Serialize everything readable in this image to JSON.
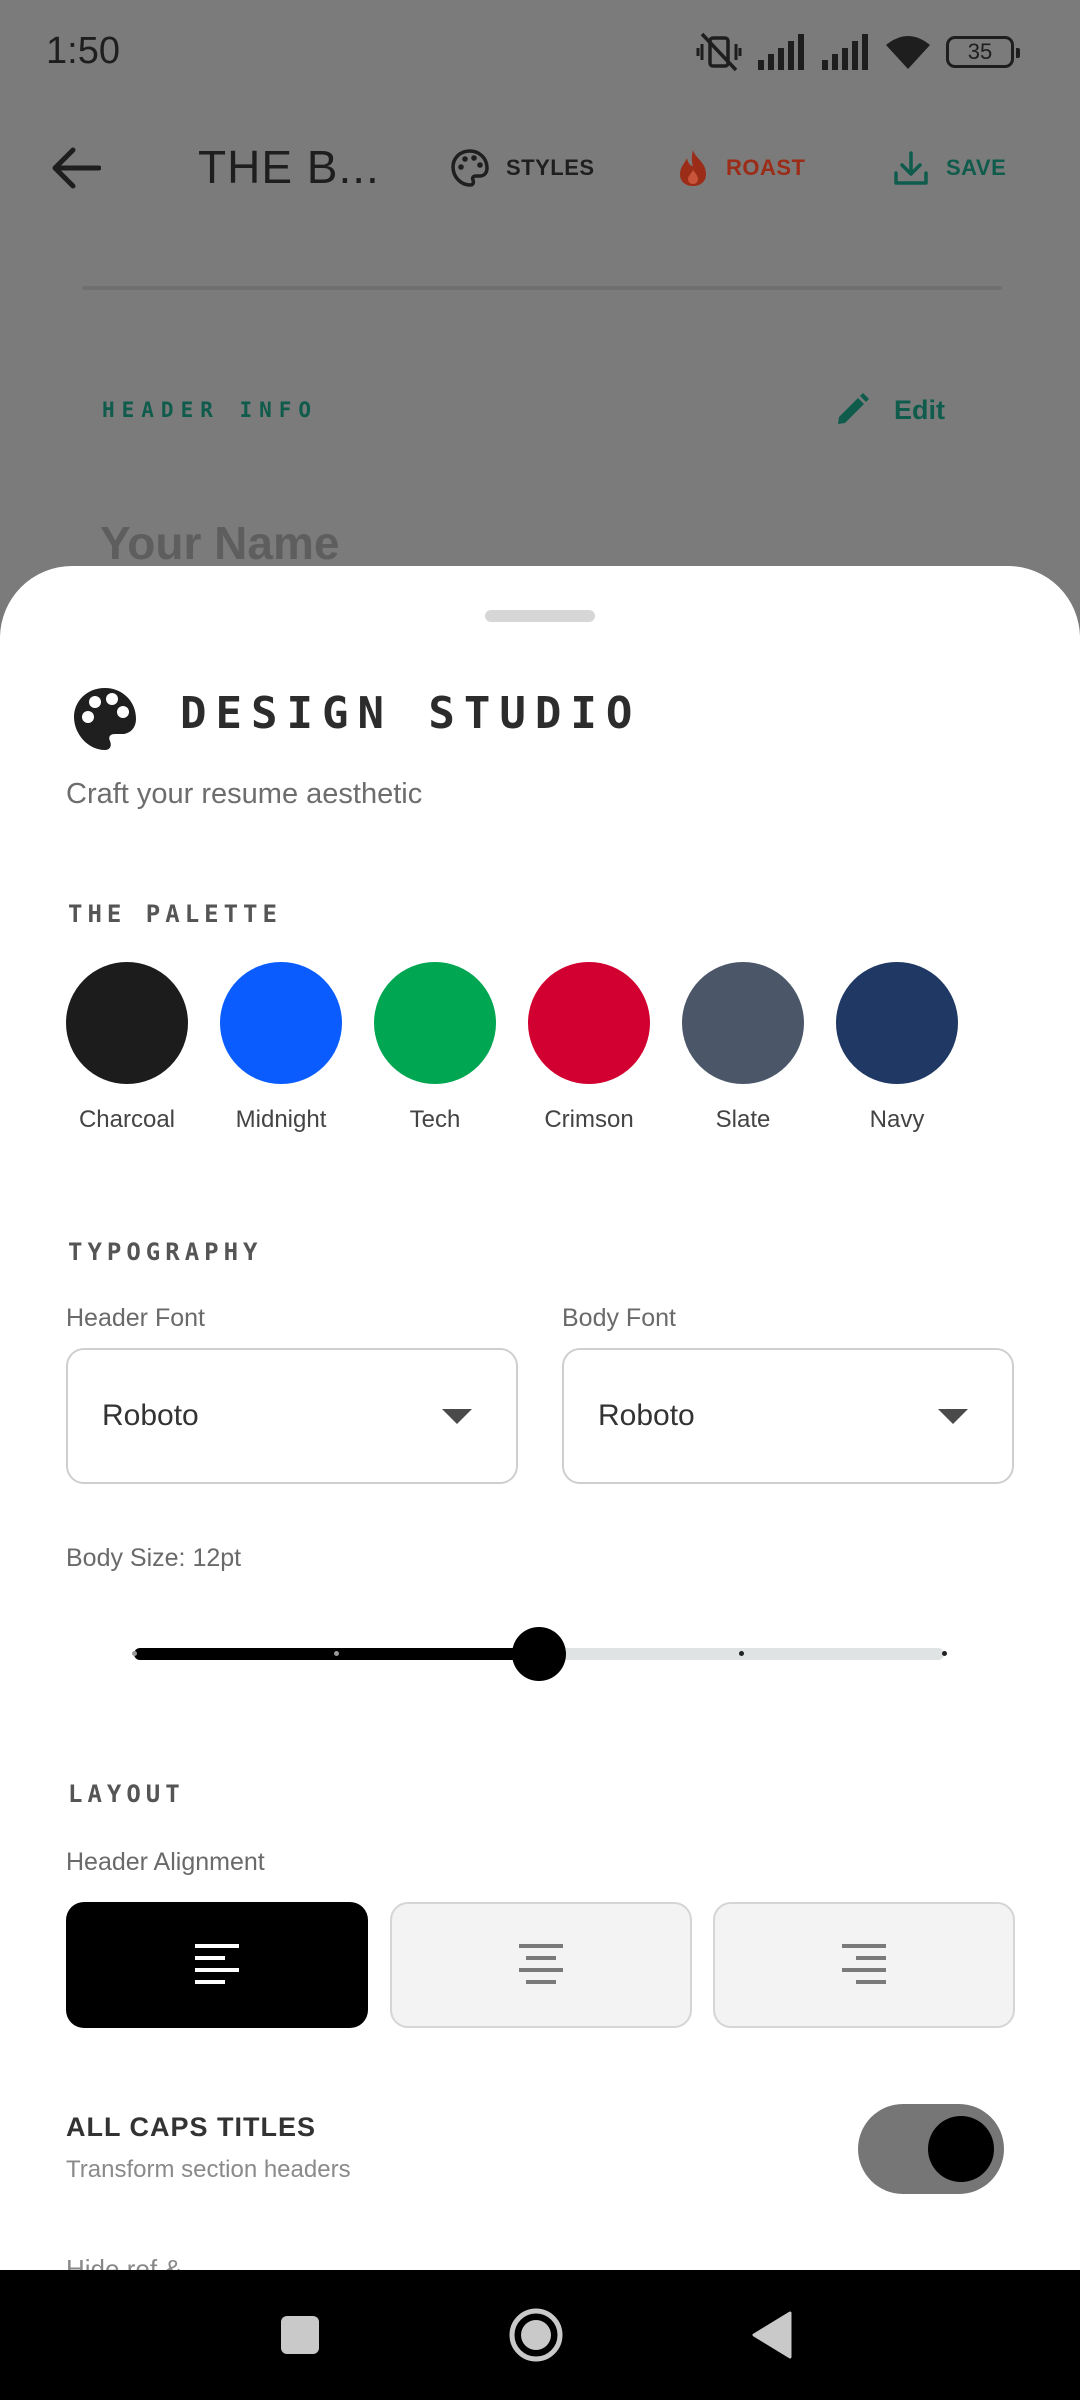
{
  "status_bar": {
    "time": "1:50",
    "battery": "35"
  },
  "toolbar": {
    "title": "THE B...",
    "styles_label": "STYLES",
    "roast_label": "ROAST",
    "save_label": "SAVE"
  },
  "background": {
    "section_label": "HEADER INFO",
    "edit_label": "Edit",
    "name_placeholder": "Your Name"
  },
  "sheet": {
    "title": "DESIGN STUDIO",
    "subtitle": "Craft your resume aesthetic",
    "palette": {
      "label": "THE PALETTE",
      "swatches": [
        {
          "name": "Charcoal",
          "color": "#1c1c1c"
        },
        {
          "name": "Midnight",
          "color": "#0a5cff"
        },
        {
          "name": "Tech",
          "color": "#00a651"
        },
        {
          "name": "Crimson",
          "color": "#d10030"
        },
        {
          "name": "Slate",
          "color": "#4b5669"
        },
        {
          "name": "Navy",
          "color": "#1f3864"
        }
      ]
    },
    "typography": {
      "label": "TYPOGRAPHY",
      "header_font_label": "Header Font",
      "header_font_value": "Roboto",
      "body_font_label": "Body Font",
      "body_font_value": "Roboto",
      "body_size_label": "Body Size: 12pt",
      "body_size_slider": {
        "min": 8,
        "max": 16,
        "step": 2,
        "value": 12
      }
    },
    "layout": {
      "label": "LAYOUT",
      "header_alignment_label": "Header Alignment",
      "alignment_options": [
        "left",
        "center",
        "right"
      ],
      "selected_alignment": "left"
    },
    "caps": {
      "title": "ALL CAPS TITLES",
      "subtitle": "Transform section headers",
      "enabled": true
    },
    "truncated_text": "Hide ref & Contact"
  },
  "colors": {
    "accent_teal": "#0f5c4d",
    "roast_red": "#9b2c17",
    "active_black": "#000000"
  }
}
